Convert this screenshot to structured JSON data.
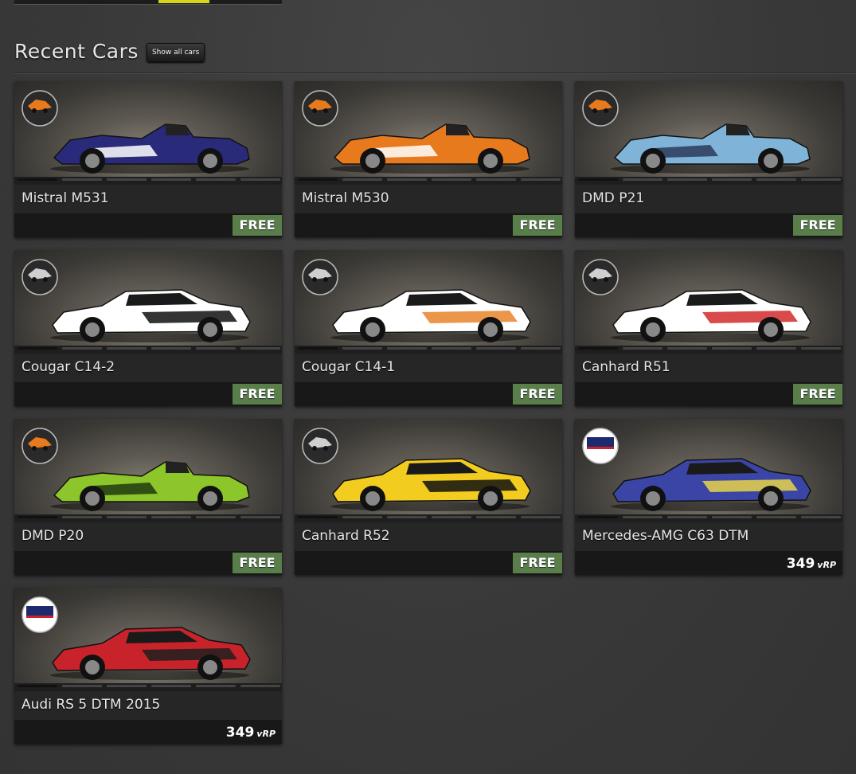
{
  "header": {
    "title": "Recent Cars",
    "show_all_label": "Show all cars"
  },
  "cars": [
    {
      "name": "Mistral M531",
      "price": "FREE",
      "class_badge": "Prototype",
      "colors": [
        "#2a2a7a",
        "#ffffff"
      ]
    },
    {
      "name": "Mistral M530",
      "price": "FREE",
      "class_badge": "Prototype",
      "colors": [
        "#e87a1e",
        "#ffffff"
      ]
    },
    {
      "name": "DMD P21",
      "price": "FREE",
      "class_badge": "Prototype",
      "colors": [
        "#7fb4d8",
        "#2b3a5a"
      ]
    },
    {
      "name": "Cougar C14-2",
      "price": "FREE",
      "class_badge": "Silhouette",
      "colors": [
        "#ffffff",
        "#111111"
      ]
    },
    {
      "name": "Cougar C14-1",
      "price": "FREE",
      "class_badge": "Silhouette",
      "colors": [
        "#ffffff",
        "#e8842a"
      ]
    },
    {
      "name": "Canhard R51",
      "price": "FREE",
      "class_badge": "Silhouette",
      "colors": [
        "#ffffff",
        "#d22b2b"
      ]
    },
    {
      "name": "DMD P20",
      "price": "FREE",
      "class_badge": "Prototype",
      "colors": [
        "#8cc62a",
        "#1e3a12"
      ]
    },
    {
      "name": "Canhard R52",
      "price": "FREE",
      "class_badge": "Silhouette",
      "colors": [
        "#f2cc1e",
        "#111111"
      ]
    },
    {
      "name": "Mercedes-AMG C63 DTM",
      "price": "349",
      "price_unit": "vRP",
      "class_badge": "DTM 2015",
      "colors": [
        "#3a45a6",
        "#e8d34a"
      ]
    },
    {
      "name": "Audi RS 5 DTM 2015",
      "price": "349",
      "price_unit": "vRP",
      "class_badge": "DTM 2015",
      "colors": [
        "#c8232a",
        "#1e1e1e"
      ]
    }
  ]
}
